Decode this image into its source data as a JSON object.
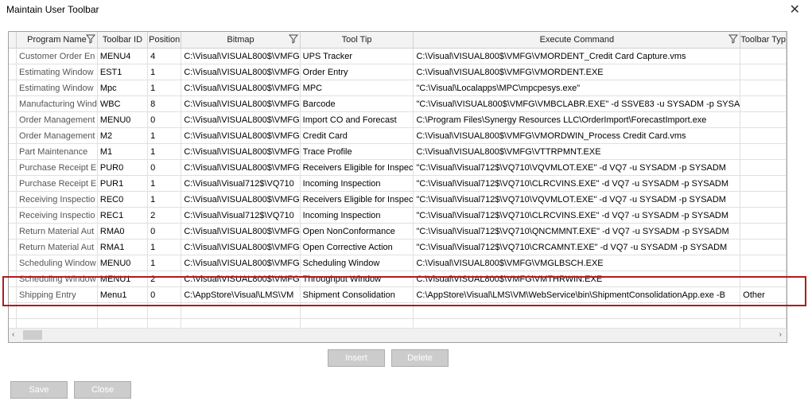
{
  "window": {
    "title": "Maintain User Toolbar",
    "close_glyph": "✕"
  },
  "columns": [
    "Program Name",
    "Toolbar ID",
    "Position",
    "Bitmap",
    "Tool Tip",
    "Execute Command",
    "Toolbar Typ"
  ],
  "rows": [
    [
      "Customer Order En",
      "MENU4",
      "4",
      "C:\\Visual\\VISUAL800$\\VMFG",
      "UPS Tracker",
      "C:\\Visual\\VISUAL800$\\VMFG\\VMORDENT_Credit Card Capture.vms",
      ""
    ],
    [
      "Estimating Window",
      "EST1",
      "1",
      "C:\\Visual\\VISUAL800$\\VMFG",
      "Order Entry",
      "C:\\Visual\\VISUAL800$\\VMFG\\VMORDENT.EXE",
      ""
    ],
    [
      "Estimating Window",
      "Mpc",
      "1",
      "C:\\Visual\\VISUAL800$\\VMFG",
      "MPC",
      "\"C:\\Visual\\Localapps\\MPC\\mpcpesys.exe\"",
      ""
    ],
    [
      "Manufacturing Wind",
      "WBC",
      "8",
      "C:\\Visual\\VISUAL800$\\VMFG",
      "Barcode",
      "\"C:\\Visual\\VISUAL800$\\VMFG\\VMBCLABR.EXE\" -d SSVE83 -u SYSADM -p SYSA",
      ""
    ],
    [
      "Order Management",
      "MENU0",
      "0",
      "C:\\Visual\\VISUAL800$\\VMFG",
      "Import CO and Forecast",
      "C:\\Program Files\\Synergy Resources LLC\\OrderImport\\ForecastImport.exe",
      ""
    ],
    [
      "Order Management",
      "M2",
      "1",
      "C:\\Visual\\VISUAL800$\\VMFG",
      "Credit Card",
      "C:\\Visual\\VISUAL800$\\VMFG\\VMORDWIN_Process Credit Card.vms",
      ""
    ],
    [
      "Part Maintenance",
      "M1",
      "1",
      "C:\\Visual\\VISUAL800$\\VMFG",
      "Trace Profile",
      "C:\\Visual\\VISUAL800$\\VMFG\\VTTRPMNT.EXE",
      ""
    ],
    [
      "Purchase Receipt E",
      "PUR0",
      "0",
      "C:\\Visual\\VISUAL800$\\VMFG",
      "Receivers Eligible for Inspec",
      "\"C:\\Visual\\Visual712$\\VQ710\\VQVMLOT.EXE\" -d VQ7 -u SYSADM -p SYSADM",
      ""
    ],
    [
      "Purchase Receipt E",
      "PUR1",
      "1",
      "C:\\Visual\\Visual712$\\VQ710",
      "Incoming Inspection",
      "\"C:\\Visual\\Visual712$\\VQ710\\CLRCVINS.EXE\" -d VQ7 -u SYSADM -p SYSADM",
      ""
    ],
    [
      "Receiving Inspectio",
      "REC0",
      "1",
      "C:\\Visual\\VISUAL800$\\VMFG",
      "Receivers Eligible for Inspec",
      "\"C:\\Visual\\Visual712$\\VQ710\\VQVMLOT.EXE\" -d VQ7 -u SYSADM -p SYSADM",
      ""
    ],
    [
      "Receiving Inspectio",
      "REC1",
      "2",
      "C:\\Visual\\Visual712$\\VQ710",
      "Incoming Inspection",
      "\"C:\\Visual\\Visual712$\\VQ710\\CLRCVINS.EXE\" -d VQ7 -u SYSADM -p SYSADM",
      ""
    ],
    [
      "Return Material Aut",
      "RMA0",
      "0",
      "C:\\Visual\\VISUAL800$\\VMFG",
      "Open NonConformance",
      "\"C:\\Visual\\Visual712$\\VQ710\\QNCMMNT.EXE\" -d VQ7 -u SYSADM -p SYSADM",
      ""
    ],
    [
      "Return Material Aut",
      "RMA1",
      "1",
      "C:\\Visual\\VISUAL800$\\VMFG",
      "Open Corrective Action",
      "\"C:\\Visual\\Visual712$\\VQ710\\CRCAMNT.EXE\" -d VQ7 -u SYSADM -p SYSADM",
      ""
    ],
    [
      "Scheduling Window",
      "MENU0",
      "1",
      "C:\\Visual\\VISUAL800$\\VMFG",
      "Scheduling Window",
      "C:\\Visual\\VISUAL800$\\VMFG\\VMGLBSCH.EXE",
      ""
    ],
    [
      "Scheduling Window",
      "MENU1",
      "2",
      "C:\\Visual\\VISUAL800$\\VMFG",
      "Throughput Window",
      "C:\\Visual\\VISUAL800$\\VMFG\\VMTHRWIN.EXE",
      ""
    ],
    [
      "Shipping Entry",
      "Menu1",
      "0",
      "C:\\AppStore\\Visual\\LMS\\VM",
      "Shipment Consolidation",
      "C:\\AppStore\\Visual\\LMS\\VM\\WebService\\bin\\ShipmentConsolidationApp.exe -B",
      "Other"
    ]
  ],
  "buttons": {
    "insert": "Insert",
    "delete": "Delete",
    "save": "Save",
    "close": "Close"
  },
  "icons": {
    "filter": "filter-icon",
    "scroll_left": "‹",
    "scroll_right": "›"
  },
  "colors": {
    "highlight": "#b01c1c",
    "disabled_button": "#cccccc"
  }
}
